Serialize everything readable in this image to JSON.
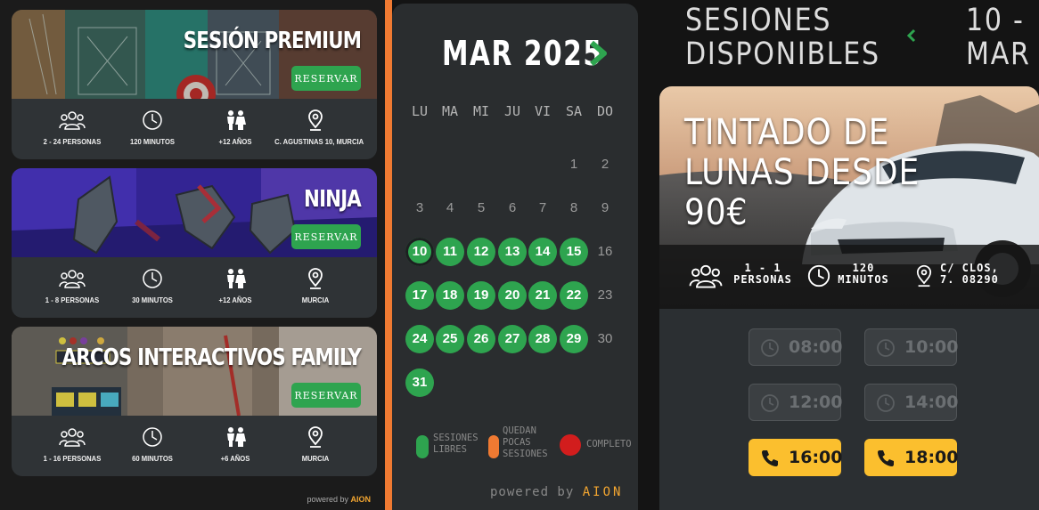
{
  "activities": [
    {
      "title": "SESIÓN PREMIUM",
      "button": "RESERVAR",
      "people": "2 - 24 PERSONAS",
      "duration": "120 MINUTOS",
      "age": "+12 AÑOS",
      "location": "C. AGUSTINAS 10, MURCIA"
    },
    {
      "title": "NINJA",
      "button": "RESERVAR",
      "people": "1 - 8 PERSONAS",
      "duration": "30 MINUTOS",
      "age": "+12 AÑOS",
      "location": "MURCIA"
    },
    {
      "title": "ARCOS INTERACTIVOS FAMILY",
      "button": "RESERVAR",
      "people": "1 - 16 PERSONAS",
      "duration": "60 MINUTOS",
      "age": "+6 AÑOS",
      "location": "MURCIA"
    }
  ],
  "powered_left": {
    "prefix": "powered by",
    "brand": "AION"
  },
  "calendar": {
    "month": "MAR 2025",
    "weekdays": [
      "LU",
      "MA",
      "MI",
      "JU",
      "VI",
      "SA",
      "DO"
    ],
    "selected_day": "10",
    "days": [
      {
        "d": "1",
        "status": "none"
      },
      {
        "d": "2",
        "status": "none"
      },
      {
        "d": "3",
        "status": "none"
      },
      {
        "d": "4",
        "status": "none"
      },
      {
        "d": "5",
        "status": "none"
      },
      {
        "d": "6",
        "status": "none"
      },
      {
        "d": "7",
        "status": "none"
      },
      {
        "d": "8",
        "status": "none"
      },
      {
        "d": "9",
        "status": "none"
      },
      {
        "d": "10",
        "status": "free"
      },
      {
        "d": "11",
        "status": "free"
      },
      {
        "d": "12",
        "status": "free"
      },
      {
        "d": "13",
        "status": "free"
      },
      {
        "d": "14",
        "status": "free"
      },
      {
        "d": "15",
        "status": "free"
      },
      {
        "d": "16",
        "status": "none"
      },
      {
        "d": "17",
        "status": "free"
      },
      {
        "d": "18",
        "status": "free"
      },
      {
        "d": "19",
        "status": "free"
      },
      {
        "d": "20",
        "status": "free"
      },
      {
        "d": "21",
        "status": "free"
      },
      {
        "d": "22",
        "status": "free"
      },
      {
        "d": "23",
        "status": "none"
      },
      {
        "d": "24",
        "status": "free"
      },
      {
        "d": "25",
        "status": "free"
      },
      {
        "d": "26",
        "status": "free"
      },
      {
        "d": "27",
        "status": "free"
      },
      {
        "d": "28",
        "status": "free"
      },
      {
        "d": "29",
        "status": "free"
      },
      {
        "d": "30",
        "status": "none"
      },
      {
        "d": "31",
        "status": "free"
      }
    ],
    "legend": [
      {
        "line1": "SESIONES",
        "line2": "LIBRES",
        "line3": "",
        "color": "#2ea44f"
      },
      {
        "line1": "QUEDAN",
        "line2": "POCAS",
        "line3": "SESIONES",
        "color": "#f07a32"
      },
      {
        "line1": "COMPLETO",
        "line2": "",
        "line3": "",
        "color": "#d21d1d"
      }
    ],
    "powered": {
      "prefix": "powered by",
      "brand": "AION"
    }
  },
  "sessions": {
    "header_line1": "SESIONES",
    "header_line2": "DISPONIBLES",
    "date_line1": "10 -",
    "date_line2": "MAR",
    "offer": {
      "title_line1": "TINTADO DE",
      "title_line2": "LUNAS DESDE",
      "title_line3": "90€",
      "people_line1": "1 - 1",
      "people_line2": "PERSONAS",
      "duration_line1": "120",
      "duration_line2": "MINUTOS",
      "location_line1": "C/ CLOS,",
      "location_line2": "7. 08290"
    },
    "slots": [
      {
        "time": "08:00",
        "available": false,
        "icon": "clock-icon"
      },
      {
        "time": "10:00",
        "available": false,
        "icon": "clock-icon"
      },
      {
        "time": "12:00",
        "available": false,
        "icon": "clock-icon"
      },
      {
        "time": "14:00",
        "available": false,
        "icon": "clock-icon"
      },
      {
        "time": "16:00",
        "available": true,
        "icon": "phone-icon"
      },
      {
        "time": "18:00",
        "available": true,
        "icon": "phone-icon"
      }
    ]
  },
  "colors": {
    "green": "#2ea44f",
    "orange": "#f07a32",
    "red": "#d21d1d",
    "yellow": "#fbbf2e",
    "panel": "#2a2d2f"
  }
}
